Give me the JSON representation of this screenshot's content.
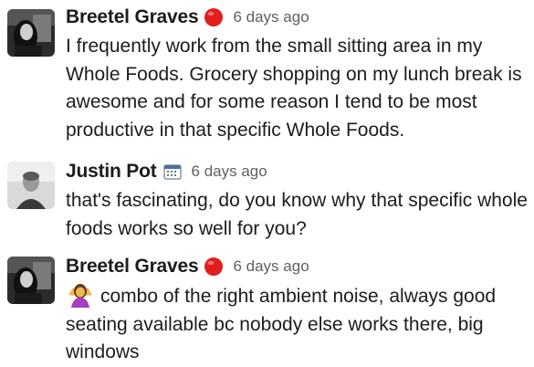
{
  "messages": [
    {
      "author": "Breetel Graves",
      "status_icon": "red-circle-icon",
      "timestamp": "6 days ago",
      "text": "I frequently work from the small sitting area in my Whole Foods. Grocery shopping on my lunch break is awesome and for some reason I tend to be most productive in that specific Whole Foods."
    },
    {
      "author": "Justin Pot",
      "status_icon": "calendar-icon",
      "timestamp": "6 days ago",
      "text": "that's fascinating, do you know why that specific whole foods works so well for you?"
    },
    {
      "author": "Breetel Graves",
      "status_icon": "red-circle-icon",
      "timestamp": "6 days ago",
      "emoji": "person-shrugging-icon",
      "text": "combo of the right ambient noise, always good seating available bc nobody else works there, big windows"
    }
  ],
  "colors": {
    "text": "#1d1c1d",
    "timestamp": "#616061",
    "status_red": "#e01e1e",
    "background": "#ffffff"
  }
}
